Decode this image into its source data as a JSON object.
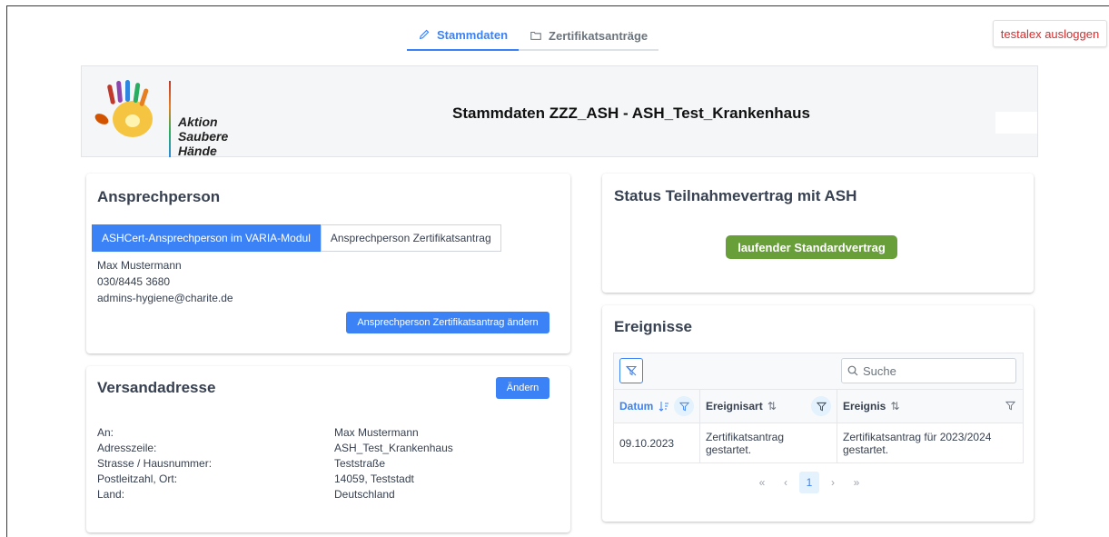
{
  "nav": {
    "tabs": [
      {
        "label": "Stammdaten",
        "icon": "pencil-icon",
        "active": true
      },
      {
        "label": "Zertifikatsanträge",
        "icon": "folder-icon",
        "active": false
      }
    ],
    "logout_label": "testalex ausloggen"
  },
  "header": {
    "title": "Stammdaten ZZZ_ASH - ASH_Test_Krankenhaus",
    "logo_line1": "Aktion",
    "logo_line2": "Saubere Hände"
  },
  "contact": {
    "title": "Ansprechperson",
    "tabs": [
      "ASHCert-Ansprechperson im VARIA-Modul",
      "Ansprechperson Zertifikatsantrag"
    ],
    "name": "Max Mustermann",
    "phone": "030/8445 3680",
    "email": "admins-hygiene@charite.de",
    "edit_button": "Ansprechperson Zertifikatsantrag ändern"
  },
  "shipping": {
    "title": "Versandadresse",
    "edit_button": "Ändern",
    "rows": [
      {
        "label": "An:",
        "value": "Max Mustermann"
      },
      {
        "label": "Adresszeile:",
        "value": "ASH_Test_Krankenhaus"
      },
      {
        "label": "Strasse / Hausnummer:",
        "value": "Teststraße"
      },
      {
        "label": "Postleitzahl, Ort:",
        "value": "14059, Teststadt"
      },
      {
        "label": "Land:",
        "value": "Deutschland"
      }
    ]
  },
  "status": {
    "title": "Status Teilnahmevertrag mit ASH",
    "badge": "laufender Standardvertrag",
    "badge_color": "#689f38"
  },
  "events": {
    "title": "Ereignisse",
    "search_placeholder": "Suche",
    "columns": [
      "Datum",
      "Ereignisart",
      "Ereignis"
    ],
    "rows": [
      {
        "date": "09.10.2023",
        "type": "Zertifikatsantrag gestartet.",
        "event": "Zertifikatsantrag für 2023/2024 gestartet."
      }
    ],
    "pager": {
      "first": "«",
      "prev": "‹",
      "page": "1",
      "next": "›",
      "last": "»"
    }
  },
  "colors": {
    "accent": "#3b82f6",
    "logout": "#d32f2f"
  }
}
